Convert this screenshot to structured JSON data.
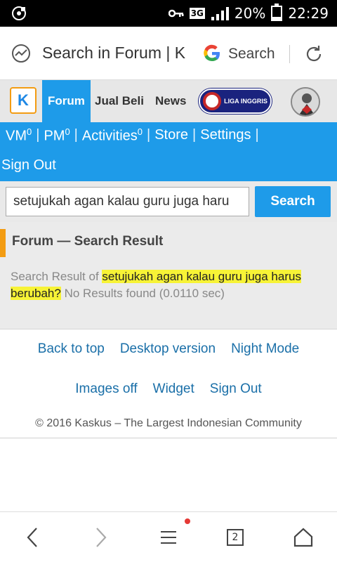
{
  "status_bar": {
    "signal_type": "3G",
    "battery_percent": "20%",
    "battery_level": 0.2,
    "time": "22:29"
  },
  "browser": {
    "url_text": "Search in Forum | K",
    "search_label": "Search"
  },
  "kaskus_header": {
    "logo_text": "K",
    "tabs": [
      "Forum",
      "Jual Beli",
      "News"
    ],
    "liga_text": "LIGA INGGRIS"
  },
  "user_menu": {
    "vm_label": "VM",
    "vm_count": "0",
    "pm_label": "PM",
    "pm_count": "0",
    "activities_label": "Activities",
    "activities_count": "0",
    "store_label": "Store",
    "settings_label": "Settings",
    "signout_label": "Sign Out"
  },
  "search": {
    "query": "setujukah agan kalau guru juga haru",
    "button_label": "Search"
  },
  "results": {
    "title": "Forum — Search Result",
    "prefix": "Search Result of ",
    "query_highlight": "setujukah agan kalau guru juga harus berubah?",
    "suffix": " No Results found (0.0110 sec)"
  },
  "footer": {
    "links_row1": [
      "Back to top",
      "Desktop version",
      "Night Mode"
    ],
    "links_row2": [
      "Images off",
      "Widget",
      "Sign Out"
    ],
    "copyright": "© 2016 Kaskus – The Largest Indonesian Community"
  },
  "bottom_nav": {
    "tab_count": "2"
  },
  "colors": {
    "kaskus_blue": "#1e9be9",
    "accent_orange": "#f39c12",
    "highlight_yellow": "#f7f336"
  }
}
